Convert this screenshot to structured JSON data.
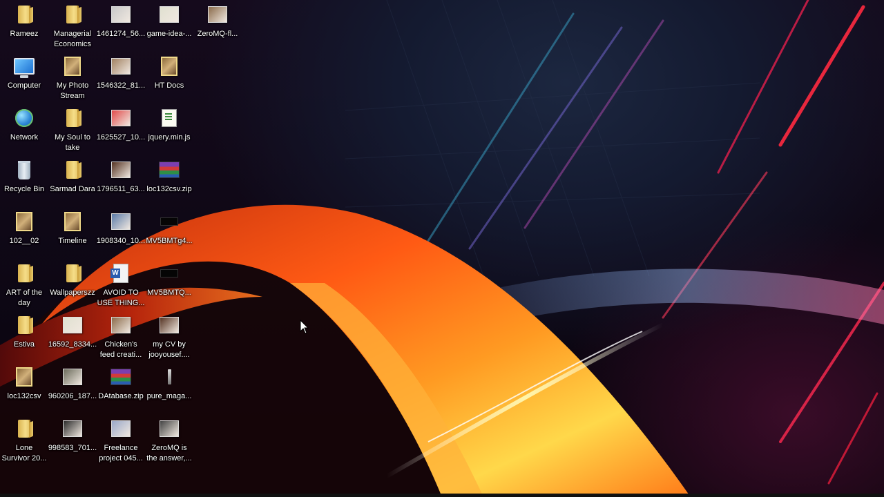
{
  "desktop": {
    "icons": [
      {
        "label": "Rameez",
        "icon": "folder-icon"
      },
      {
        "label": "Computer",
        "icon": "computer-icon"
      },
      {
        "label": "Network",
        "icon": "network-icon"
      },
      {
        "label": "Recycle Bin",
        "icon": "recycle-bin-icon"
      },
      {
        "label": "102__02",
        "icon": "folder-icon"
      },
      {
        "label": "ART of the\nday",
        "icon": "folder-icon"
      },
      {
        "label": "Estiva",
        "icon": "folder-icon"
      },
      {
        "label": "loc132csv",
        "icon": "folder-icon"
      },
      {
        "label": "Lone\nSurvivor 20...",
        "icon": "folder-icon"
      },
      {
        "label": "Managerial\nEconomics",
        "icon": "folder-icon"
      },
      {
        "label": "My Photo\nStream",
        "icon": "folder-icon"
      },
      {
        "label": "My Soul to\ntake",
        "icon": "folder-icon"
      },
      {
        "label": "Sarmad Dara",
        "icon": "folder-icon"
      },
      {
        "label": "Timeline",
        "icon": "folder-icon"
      },
      {
        "label": "Wallpaperszz",
        "icon": "folder-icon"
      },
      {
        "label": "16592_8334...",
        "icon": "image-file-icon"
      },
      {
        "label": "960206_187...",
        "icon": "image-file-icon"
      },
      {
        "label": "998583_701...",
        "icon": "image-file-icon"
      },
      {
        "label": "1461274_56...",
        "icon": "image-file-icon"
      },
      {
        "label": "1546322_81...",
        "icon": "image-file-icon"
      },
      {
        "label": "1625527_10...",
        "icon": "image-file-icon"
      },
      {
        "label": "1796511_63...",
        "icon": "image-file-icon"
      },
      {
        "label": "1908340_10...",
        "icon": "image-file-icon"
      },
      {
        "label": "AVOID TO\nUSE THING...",
        "icon": "word-document-icon"
      },
      {
        "label": "Chicken's\nfeed creati...",
        "icon": "image-file-icon"
      },
      {
        "label": "DAtabase.zip",
        "icon": "zip-archive-icon"
      },
      {
        "label": "Freelance\nproject 045...",
        "icon": "image-file-icon"
      },
      {
        "label": "game-idea-...",
        "icon": "image-file-icon"
      },
      {
        "label": "HT Docs",
        "icon": "folder-icon"
      },
      {
        "label": "jquery.min.js",
        "icon": "script-file-icon"
      },
      {
        "label": "loc132csv.zip",
        "icon": "zip-archive-icon"
      },
      {
        "label": "MV5BMTg4...",
        "icon": "image-file-icon"
      },
      {
        "label": "MV5BMTQ...",
        "icon": "image-file-icon"
      },
      {
        "label": "my CV by\njooyousef....",
        "icon": "image-file-icon"
      },
      {
        "label": "pure_maga...",
        "icon": "image-file-icon"
      },
      {
        "label": "ZeroMQ is\nthe answer,...",
        "icon": "image-file-icon"
      },
      {
        "label": "ZeroMQ-fl...",
        "icon": "image-file-icon"
      }
    ]
  },
  "colors": {
    "label_text": "#ffffff",
    "wallpaper_orange": "#ff6a1a",
    "wallpaper_yellow": "#ffd84a",
    "wallpaper_red": "#ff2a40"
  }
}
